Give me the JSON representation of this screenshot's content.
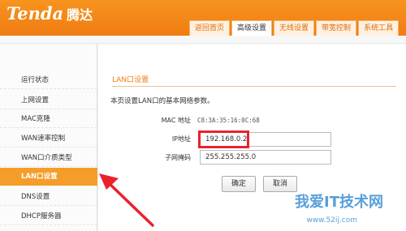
{
  "brand": {
    "logo": "Tenda",
    "logo_cn": "腾达"
  },
  "tabs": [
    {
      "label": "返回首页"
    },
    {
      "label": "高级设置"
    },
    {
      "label": "无线设置"
    },
    {
      "label": "带宽控制"
    },
    {
      "label": "系统工具"
    }
  ],
  "sidebar": {
    "items": [
      {
        "label": "运行状态"
      },
      {
        "label": "上网设置"
      },
      {
        "label": "MAC克隆"
      },
      {
        "label": "WAN速率控制"
      },
      {
        "label": "WAN口介质类型"
      },
      {
        "label": "LAN口设置"
      },
      {
        "label": "DNS设置"
      },
      {
        "label": "DHCP服务器"
      }
    ]
  },
  "main": {
    "title": "LAN口设置",
    "description": "本页设置LAN口的基本网络参数。",
    "mac_label": "MAC 地址",
    "mac_value": "C8:3A:35:16:0C:68",
    "ip_label": "IP地址",
    "ip_value": "192.168.0.2",
    "mask_label": "子网掩码",
    "mask_value": "255.255.255.0",
    "ok_button": "确定",
    "cancel_button": "取消"
  },
  "watermark": {
    "title": "我爱IT技术网",
    "url": "www.52ij.com"
  },
  "colors": {
    "brand_orange": "#f07c12",
    "highlight_red": "#e8232b",
    "active_item": "#f49d2a"
  }
}
